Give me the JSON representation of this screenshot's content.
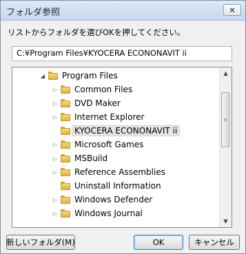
{
  "window": {
    "title": "フォルダ参照",
    "close_label": "✕"
  },
  "instruction": "リストからフォルダを選びOKを押してください。",
  "path_value": "C:¥Program Files¥KYOCERA ECONONAVIT ii",
  "tree": {
    "root": {
      "label": "Program Files",
      "icon": "folder-icon"
    },
    "items": [
      {
        "label": "Common Files",
        "expandable": true
      },
      {
        "label": "DVD Maker",
        "expandable": true
      },
      {
        "label": "Internet Explorer",
        "expandable": true
      },
      {
        "label": "KYOCERA ECONONAVIT ii",
        "expandable": false,
        "selected": true
      },
      {
        "label": "Microsoft Games",
        "expandable": true
      },
      {
        "label": "MSBuild",
        "expandable": true
      },
      {
        "label": "Reference Assemblies",
        "expandable": true
      },
      {
        "label": "Uninstall Information",
        "expandable": false
      },
      {
        "label": "Windows Defender",
        "expandable": true
      },
      {
        "label": "Windows Journal",
        "expandable": true
      }
    ]
  },
  "buttons": {
    "new_folder": "新しいフォルダ(M)",
    "ok": "OK",
    "cancel": "キャンセル"
  },
  "colors": {
    "titlebar": "#c5d9ee",
    "selected_row": "#e5e5e5",
    "folder": "#e2b23a"
  }
}
